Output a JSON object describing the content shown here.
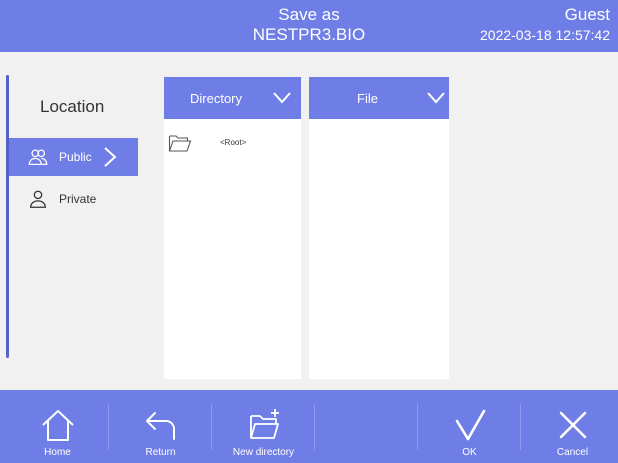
{
  "header": {
    "title": "Save as",
    "filename": "NESTPR3.BIO",
    "user": "Guest",
    "datetime": "2022-03-18 12:57:42"
  },
  "location": {
    "title": "Location",
    "items": [
      {
        "label": "Public",
        "icon": "users-icon",
        "active": true
      },
      {
        "label": "Private",
        "icon": "user-icon",
        "active": false
      }
    ]
  },
  "directory_panel": {
    "header": "Directory",
    "items": [
      {
        "label": "<Root>",
        "icon": "folder-icon"
      }
    ]
  },
  "file_panel": {
    "header": "File"
  },
  "toolbar": {
    "home": "Home",
    "return": "Return",
    "new_directory": "New directory",
    "ok": "OK",
    "cancel": "Cancel"
  },
  "colors": {
    "accent": "#6e7ee6",
    "accent_dark": "#5361c9",
    "background": "#f1f1f1"
  }
}
